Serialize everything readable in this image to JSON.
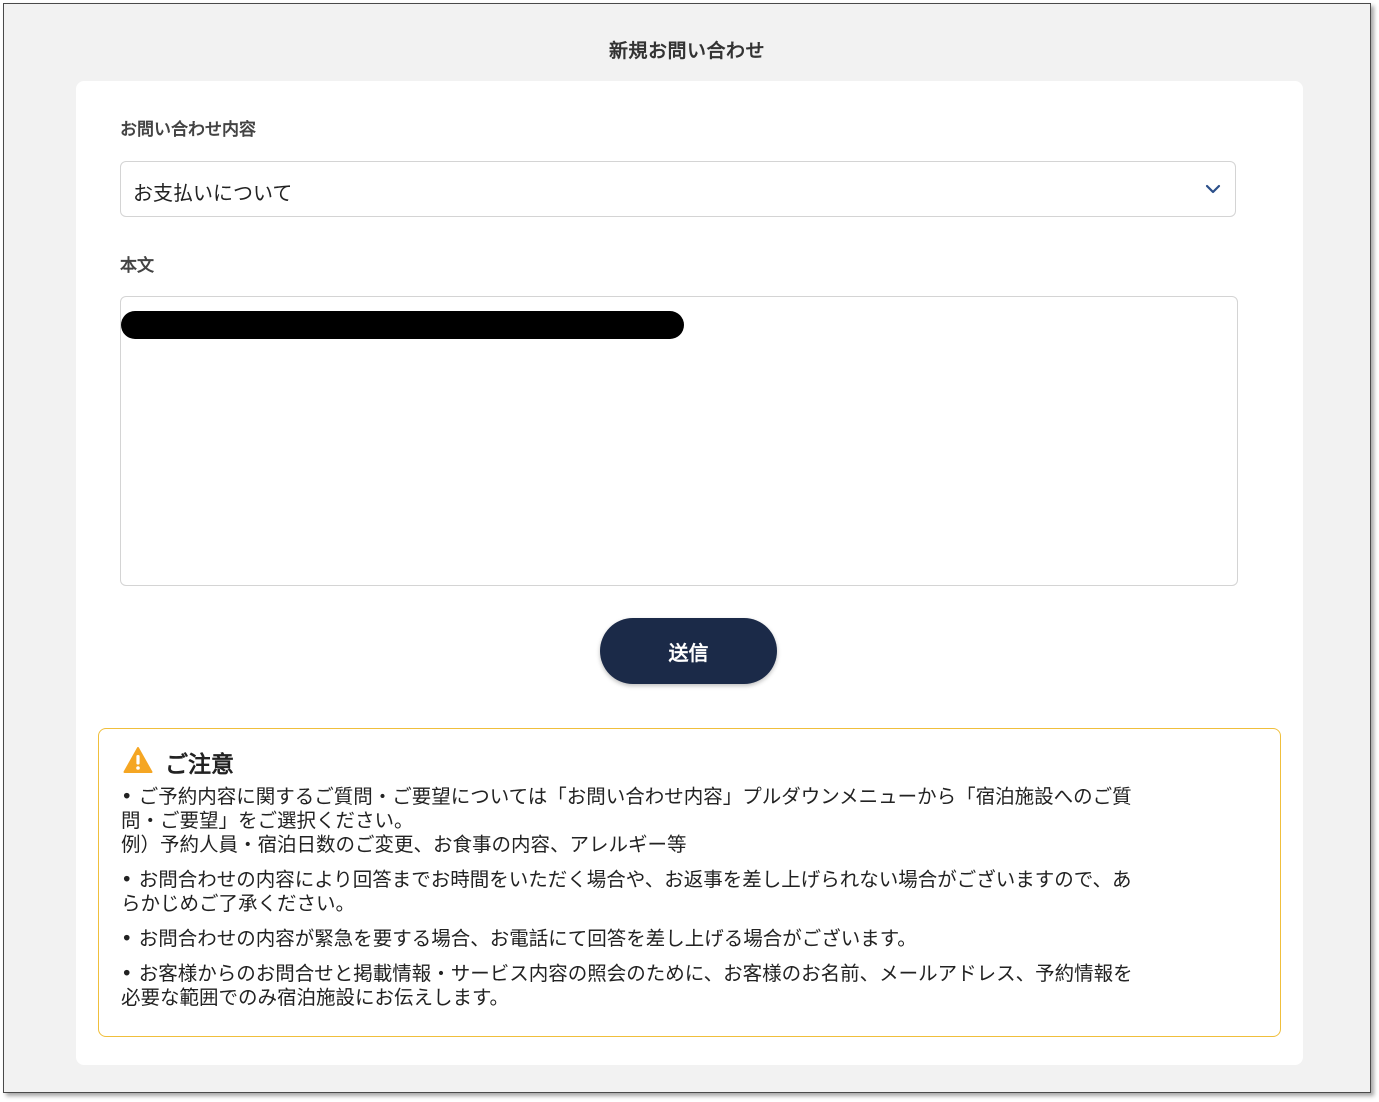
{
  "page": {
    "title": "新規お問い合わせ"
  },
  "form": {
    "category_label": "お問い合わせ内容",
    "category_value": "お支払いについて",
    "body_label": "本文",
    "submit_label": "送信"
  },
  "notice": {
    "title": "ご注意",
    "items": [
      "• ご予約内容に関するご質問・ご要望については「お問い合わせ内容」プルダウンメニューから「宿泊施設へのご質\n問・ご要望」をご選択ください。\n例）予約人員・宿泊日数のご変更、お食事の内容、アレルギー等",
      "• お問合わせの内容により回答までお時間をいただく場合や、お返事を差し上げられない場合がございますので、あ\nらかじめご了承ください。",
      "• お問合わせの内容が緊急を要する場合、お電話にて回答を差し上げる場合がございます。",
      "• お客様からのお問合せと掲載情報・サービス内容の照会のために、お客様のお名前、メールアドレス、予約情報を\n必要な範囲でのみ宿泊施設にお伝えします。"
    ]
  },
  "icons": {
    "select": "chevron-down-icon",
    "notice": "warning-icon"
  },
  "colors": {
    "submit_button": "#1b2a48",
    "notice_border": "#f0bf3c",
    "warning_icon": "#f5a623",
    "chevron": "#2b4f8a"
  }
}
